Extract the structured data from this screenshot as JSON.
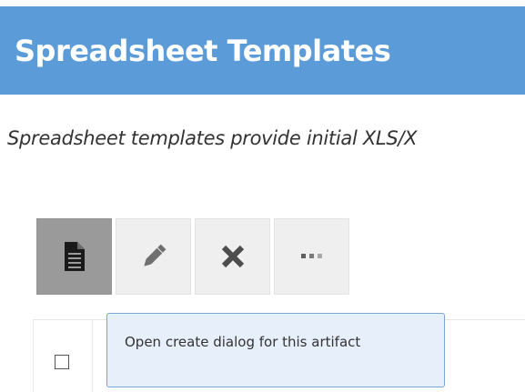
{
  "header": {
    "title": "Spreadsheet Templates",
    "background_color": "#5a9bd8"
  },
  "description": "Spreadsheet templates provide initial XLS/X",
  "toolbar": {
    "buttons": [
      {
        "name": "create",
        "icon": "document-icon",
        "active": true
      },
      {
        "name": "edit",
        "icon": "pencil-icon",
        "active": false
      },
      {
        "name": "delete",
        "icon": "x-icon",
        "active": false
      },
      {
        "name": "more",
        "icon": "more-dots-icon",
        "active": false
      }
    ]
  },
  "tooltip": {
    "text": "Open create dialog for this artifact",
    "background_color": "#e7f0fa",
    "border_color": "#7aa6d6"
  },
  "table": {
    "rows": [
      {
        "checked": false
      }
    ]
  }
}
